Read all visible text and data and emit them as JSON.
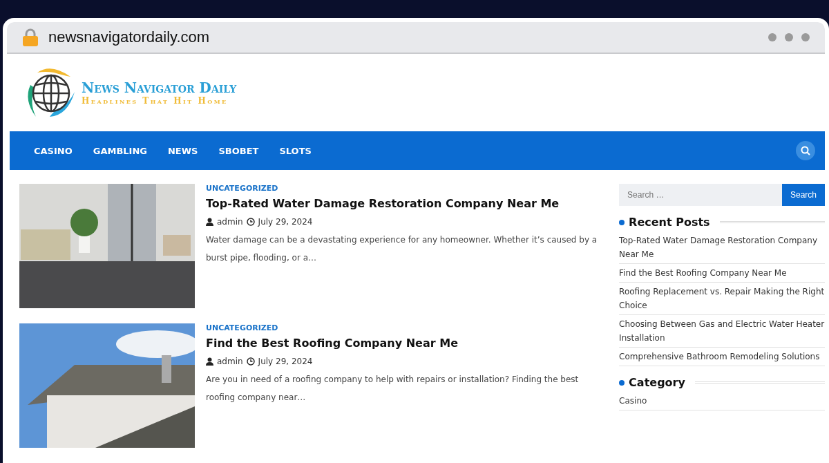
{
  "browser": {
    "url": "newsnavigatordaily.com"
  },
  "site": {
    "title": "News Navigator Daily",
    "tagline": "Headlines That Hit Home"
  },
  "nav": {
    "items": [
      {
        "label": "CASINO"
      },
      {
        "label": "GAMBLING"
      },
      {
        "label": "NEWS"
      },
      {
        "label": "SBOBET"
      },
      {
        "label": "SLOTS"
      }
    ]
  },
  "posts": [
    {
      "kind": "room",
      "category": "UNCATEGORIZED",
      "title": "Top-Rated Water Damage Restoration Company Near Me",
      "author": "admin",
      "date": "July 29, 2024",
      "excerpt": "Water damage can be a devastating experience for any homeowner. Whether it’s caused by a burst pipe, flooding, or a…"
    },
    {
      "kind": "roof",
      "category": "UNCATEGORIZED",
      "title": "Find the Best Roofing Company Near Me",
      "author": "admin",
      "date": "July 29, 2024",
      "excerpt": "Are you in need of a roofing company to help with repairs or installation? Finding the best roofing company near…"
    }
  ],
  "sidebar": {
    "search": {
      "placeholder": "Search …",
      "button": "Search"
    },
    "recent_posts": {
      "heading": "Recent Posts",
      "items": [
        "Top-Rated Water Damage Restoration Company Near Me",
        "Find the Best Roofing Company Near Me",
        "Roofing Replacement vs. Repair Making the Right Choice",
        "Choosing Between Gas and Electric Water Heater Installation",
        "Comprehensive Bathroom Remodeling Solutions"
      ]
    },
    "category": {
      "heading": "Category",
      "items": [
        "Casino"
      ]
    }
  }
}
